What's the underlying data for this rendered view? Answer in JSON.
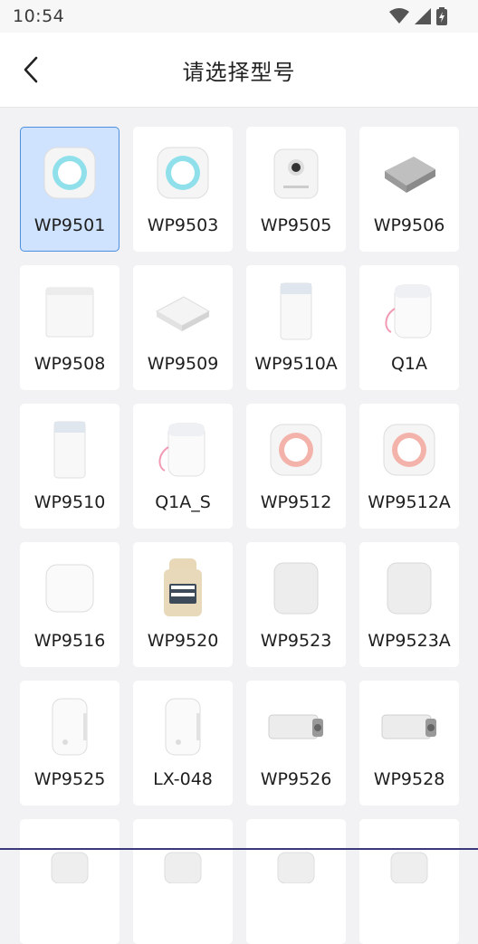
{
  "status": {
    "time": "10:54"
  },
  "header": {
    "title": "请选择型号"
  },
  "models": [
    {
      "label": "WP9501",
      "icon": "printer-round-blue-icon",
      "selected": true
    },
    {
      "label": "WP9503",
      "icon": "printer-round-blue-icon"
    },
    {
      "label": "WP9505",
      "icon": "printer-camera-icon"
    },
    {
      "label": "WP9506",
      "icon": "printer-flat-box-icon"
    },
    {
      "label": "WP9508",
      "icon": "printer-white-box-icon"
    },
    {
      "label": "WP9509",
      "icon": "printer-flat-square-icon"
    },
    {
      "label": "WP9510A",
      "icon": "printer-tall-icon"
    },
    {
      "label": "Q1A",
      "icon": "printer-lanyard-icon"
    },
    {
      "label": "WP9510",
      "icon": "printer-tall-icon"
    },
    {
      "label": "Q1A_S",
      "icon": "printer-lanyard-icon"
    },
    {
      "label": "WP9512",
      "icon": "printer-round-pink-icon"
    },
    {
      "label": "WP9512A",
      "icon": "printer-round-pink-icon"
    },
    {
      "label": "WP9516",
      "icon": "printer-white-cube-icon"
    },
    {
      "label": "WP9520",
      "icon": "printer-keypad-icon"
    },
    {
      "label": "WP9523",
      "icon": "printer-rounded-square-icon"
    },
    {
      "label": "WP9523A",
      "icon": "printer-rounded-square-icon"
    },
    {
      "label": "WP9525",
      "icon": "printer-label-maker-icon"
    },
    {
      "label": "LX-048",
      "icon": "printer-label-maker-icon"
    },
    {
      "label": "WP9526",
      "icon": "printer-horizontal-icon"
    },
    {
      "label": "WP9528",
      "icon": "printer-horizontal-icon"
    },
    {
      "label": "",
      "icon": "printer-partial-icon"
    },
    {
      "label": "",
      "icon": "printer-partial-icon"
    },
    {
      "label": "",
      "icon": "printer-partial-icon"
    },
    {
      "label": "",
      "icon": "printer-partial-icon"
    }
  ]
}
